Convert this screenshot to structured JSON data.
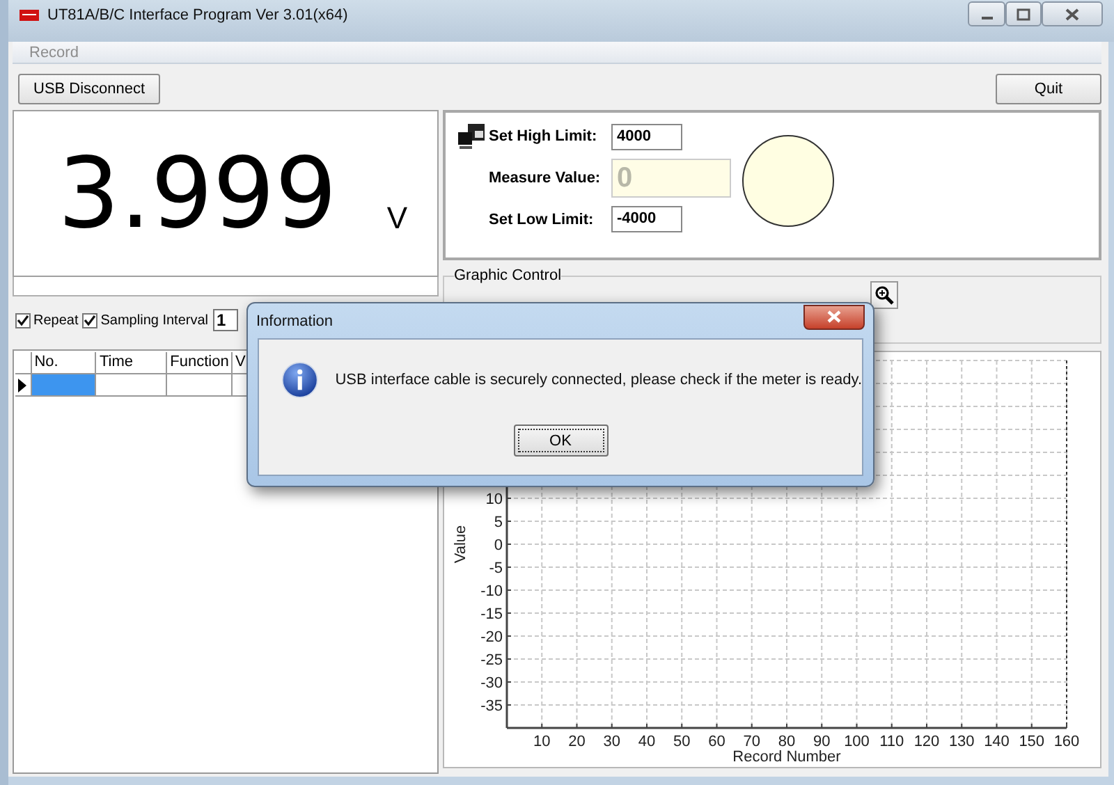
{
  "window": {
    "title": "UT81A/B/C Interface Program Ver 3.01(x64)"
  },
  "menu": [
    {
      "label": "Record",
      "disabled": true
    }
  ],
  "buttons": {
    "usb": "USB Disconnect",
    "quit": "Quit"
  },
  "display": {
    "reading": "3.999",
    "unit": "V"
  },
  "sampling": {
    "repeat": {
      "label": "Repeat",
      "checked": true
    },
    "interval": {
      "label": "Sampling Interval",
      "checked": true,
      "value": "1"
    }
  },
  "table": {
    "columns": [
      "No.",
      "Time",
      "Function",
      "V"
    ],
    "rows": [
      {
        "selected": true
      }
    ]
  },
  "limits": {
    "high": {
      "label": "Set High Limit:",
      "value": "4000"
    },
    "measure": {
      "label": "Measure Value:",
      "placeholder": "0"
    },
    "low": {
      "label": "Set Low Limit:",
      "value": "-4000"
    }
  },
  "graphic_control": {
    "title": "Graphic Control"
  },
  "chart": {
    "chart_data": {
      "type": "line",
      "grid": true,
      "xlabel": "Record Number",
      "ylabel": "Value",
      "xlim": [
        0,
        160
      ],
      "ylim": [
        -40,
        40
      ],
      "xticks": [
        10,
        20,
        30,
        40,
        50,
        60,
        70,
        80,
        90,
        100,
        110,
        120,
        130,
        140,
        150,
        160
      ],
      "yticks": [
        10,
        5,
        0,
        -5,
        -10,
        -15,
        -20,
        -25,
        -30,
        -35
      ]
    }
  },
  "dialog": {
    "title": "Information",
    "message": "USB interface cable is securely connected, please check if the meter is ready.",
    "buttons": [
      "OK"
    ]
  }
}
